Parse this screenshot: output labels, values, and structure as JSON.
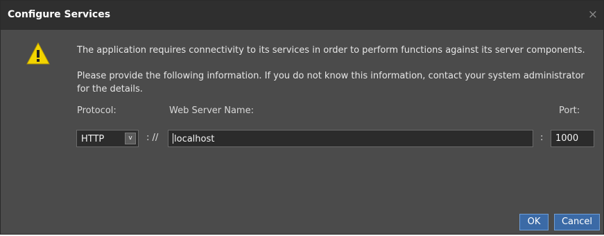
{
  "dialog": {
    "title": "Configure Services",
    "close_glyph": "×",
    "icon": "warning-icon",
    "message_line1": "The application requires connectivity to its services in order to perform functions against its server components.",
    "message_line2": "Please provide the following information. If you do not know this information, contact your system administrator for the details."
  },
  "form": {
    "protocol_label": "Protocol:",
    "protocol_value": "HTTP",
    "protocol_dropdown_glyph": "v",
    "scheme_separator": ": //",
    "web_server_label": "Web Server Name:",
    "web_server_value": "localhost",
    "port_separator": ":",
    "port_label": "Port:",
    "port_value": "1000"
  },
  "buttons": {
    "ok": "OK",
    "cancel": "Cancel"
  },
  "colors": {
    "dialog_bg": "#4b4b4b",
    "titlebar_bg": "#2f2f2f",
    "button_bg": "#3b6aa6",
    "warning": "#f2d400"
  }
}
